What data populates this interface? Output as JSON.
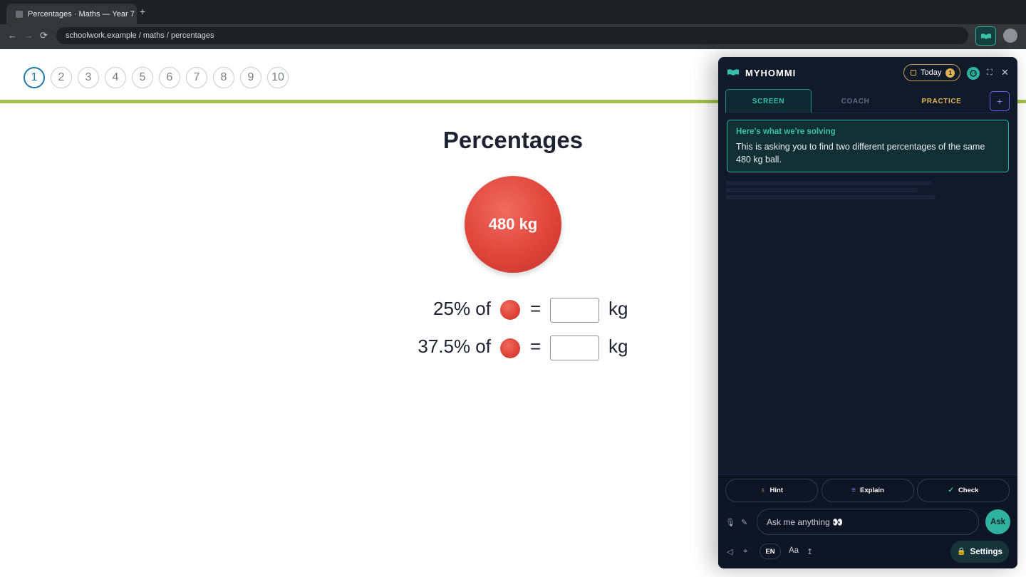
{
  "browser": {
    "tab_title": "Percentages · Maths — Year 7",
    "new_tab": "+",
    "url": "schoolwork.example / maths / percentages",
    "back": "←",
    "forward": "→",
    "reload": "⟳"
  },
  "question_nav": [
    "1",
    "2",
    "3",
    "4",
    "5",
    "6",
    "7",
    "8",
    "9",
    "10"
  ],
  "question_nav_active": "1",
  "page": {
    "title": "Percentages",
    "ball_label": "480 kg",
    "rows": [
      {
        "percent": "25% of",
        "equals": "=",
        "unit": "kg",
        "answer": ""
      },
      {
        "percent": "37.5% of",
        "equals": "=",
        "unit": "kg",
        "answer": ""
      }
    ]
  },
  "panel": {
    "brand": "MYHOMMI",
    "today_label": "Today",
    "today_count": "1",
    "tabs": [
      "SCREEN",
      "COACH",
      "PRACTICE"
    ],
    "plus": "+",
    "card_heading": "Here's what we're solving",
    "card_body": "This is asking you to find two different percentages of the same 480 kg ball.",
    "actions": {
      "hint": "Hint",
      "explain": "Explain",
      "check": "Check"
    },
    "ask_placeholder": "Ask me anything 👀",
    "ask_button": "Ask",
    "lang": "EN",
    "font_size": "Aa",
    "settings": "Settings"
  },
  "colors": {
    "accent": "#2fb39f",
    "ball": "#e0453b",
    "bar": "#a3c14a",
    "gold": "#e0b24f"
  }
}
